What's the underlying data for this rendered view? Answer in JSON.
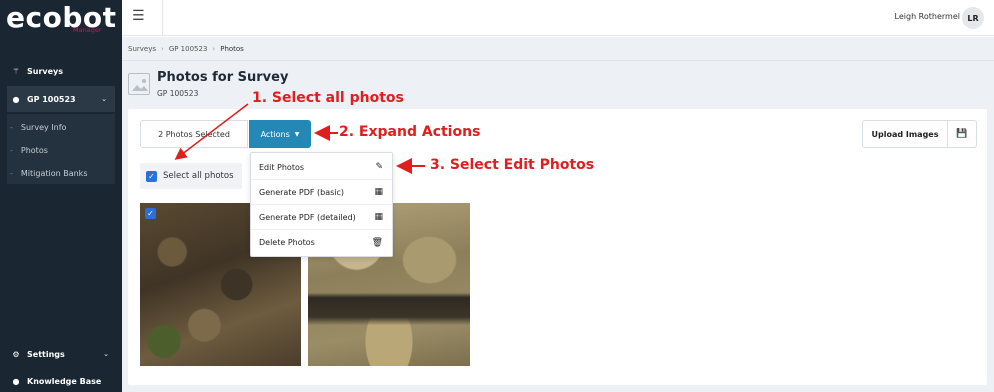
{
  "app": {
    "logo": "ecobot",
    "logo_sub": "Manager"
  },
  "sidebar": {
    "items": [
      {
        "label": "Surveys",
        "icon": "sitemap-icon"
      },
      {
        "label": "GP 100523",
        "icon": "map-pin-icon"
      }
    ],
    "sub_items": [
      "Survey Info",
      "Photos",
      "Mitigation Banks"
    ],
    "bottom": [
      {
        "label": "Settings",
        "icon": "gears-icon"
      },
      {
        "label": "Knowledge Base",
        "icon": "lightbulb-icon"
      }
    ]
  },
  "header": {
    "user_name": "Leigh Rothermel",
    "avatar_initials": "LR"
  },
  "breadcrumb": [
    "Surveys",
    "GP 100523",
    "Photos"
  ],
  "page": {
    "title": "Photos for Survey",
    "subtitle": "GP 100523"
  },
  "toolbar": {
    "selected_label": "2 Photos Selected",
    "actions_label": "Actions",
    "upload_label": "Upload Images",
    "select_all_label": "Select all photos"
  },
  "dropdown": {
    "items": [
      {
        "label": "Edit Photos",
        "icon": "edit-icon"
      },
      {
        "label": "Generate PDF (basic)",
        "icon": "file-pdf-icon"
      },
      {
        "label": "Generate PDF (detailed)",
        "icon": "file-pdf-icon"
      },
      {
        "label": "Delete Photos",
        "icon": "trash-icon"
      }
    ]
  },
  "annotations": {
    "step1": "1. Select all photos",
    "step2": "2. Expand Actions",
    "step3": "3. Select Edit Photos"
  },
  "colors": {
    "sidebar_bg": "#1a2632",
    "accent": "#2488b7",
    "annotation": "#e01e1e",
    "checkbox": "#2a6fdb"
  }
}
